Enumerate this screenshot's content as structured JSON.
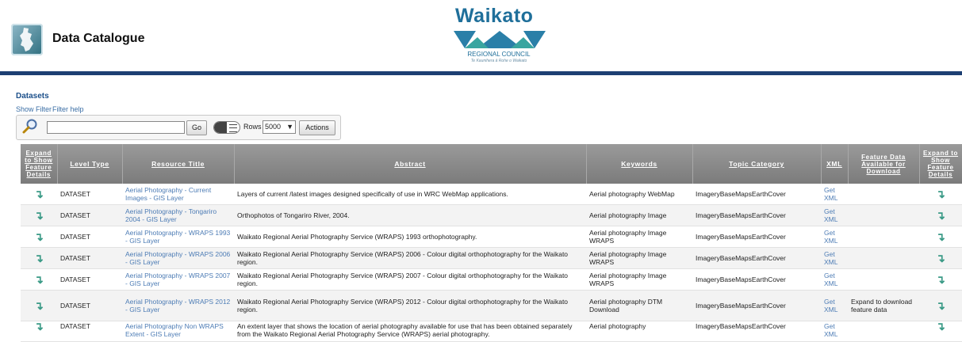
{
  "header": {
    "title": "Data Catalogue",
    "brand_name": "Waikato",
    "brand_sub": "REGIONAL COUNCIL",
    "brand_tagline": "Te Kaunihera ā Rohe o Waikato"
  },
  "datasets": {
    "section_title": "Datasets",
    "show_filter": "Show Filter",
    "filter_help": "Filter help",
    "search_value": "",
    "go_label": "Go",
    "rows_label": "Rows",
    "rows_value": "5000",
    "actions_label": "Actions"
  },
  "table": {
    "columns": [
      "Expand to Show Feature Details",
      "Level Type",
      "Resource Title",
      "Abstract",
      "Keywords",
      "Topic Category",
      "XML",
      "Feature Data Available for Download",
      "Expand to Show Feature Details"
    ],
    "rows": [
      {
        "level": "DATASET",
        "title": "Aerial Photography - Current Images - GIS Layer",
        "abstract": "Layers of current /latest images designed specifically of use in WRC WebMap applications.",
        "keywords": "Aerial photography WebMap",
        "topic": "ImageryBaseMapsEarthCover",
        "xml": "Get XML",
        "download": ""
      },
      {
        "level": "DATASET",
        "title": "Aerial Photography - Tongariro 2004 - GIS Layer",
        "abstract": "Orthophotos of Tongariro River, 2004.",
        "keywords": "Aerial photography Image",
        "topic": "ImageryBaseMapsEarthCover",
        "xml": "Get XML",
        "download": ""
      },
      {
        "level": "DATASET",
        "title": "Aerial Photography - WRAPS 1993 - GIS Layer",
        "abstract": "Waikato Regional Aerial Photography Service (WRAPS) 1993 orthophotography.",
        "keywords": "Aerial photography Image WRAPS",
        "topic": "ImageryBaseMapsEarthCover",
        "xml": "Get XML",
        "download": ""
      },
      {
        "level": "DATASET",
        "title": "Aerial Photography - WRAPS 2006 - GIS Layer",
        "abstract": "Waikato Regional Aerial Photography Service (WRAPS) 2006 - Colour digital orthophotography for the Waikato region.",
        "keywords": "Aerial photography Image WRAPS",
        "topic": "ImageryBaseMapsEarthCover",
        "xml": "Get XML",
        "download": ""
      },
      {
        "level": "DATASET",
        "title": "Aerial Photography - WRAPS 2007 - GIS Layer",
        "abstract": "Waikato Regional Aerial Photography Service (WRAPS) 2007 - Colour digital orthophotography for the Waikato region.",
        "keywords": "Aerial photography Image WRAPS",
        "topic": "ImageryBaseMapsEarthCover",
        "xml": "Get XML",
        "download": ""
      },
      {
        "level": "DATASET",
        "title": "Aerial Photography - WRAPS 2012 - GIS Layer",
        "abstract": "Waikato Regional Aerial Photography Service (WRAPS) 2012 - Colour digital orthophotography for the Waikato region.",
        "keywords": "Aerial photography DTM Download",
        "topic": "ImageryBaseMapsEarthCover",
        "xml": "Get XML",
        "download": "Expand to download feature data"
      },
      {
        "level": "DATASET",
        "title": "Aerial Photography Non WRAPS Extent - GIS Layer",
        "abstract": "An extent layer that shows the location of aerial photography available for use that has been obtained separately from the Waikato Regional Aerial Photography Service (WRAPS) aerial photography.",
        "keywords": "Aerial photography",
        "topic": "ImageryBaseMapsEarthCover",
        "xml": "Get XML",
        "download": ""
      }
    ]
  },
  "icons": {
    "expand": "expand-arrow-icon",
    "search": "search-magnifier-icon"
  },
  "colors": {
    "header_rule": "#1d3f73",
    "link": "#4d7cb5",
    "brand": "#1f6f9a",
    "expand_arrow": "#3a9a86"
  }
}
